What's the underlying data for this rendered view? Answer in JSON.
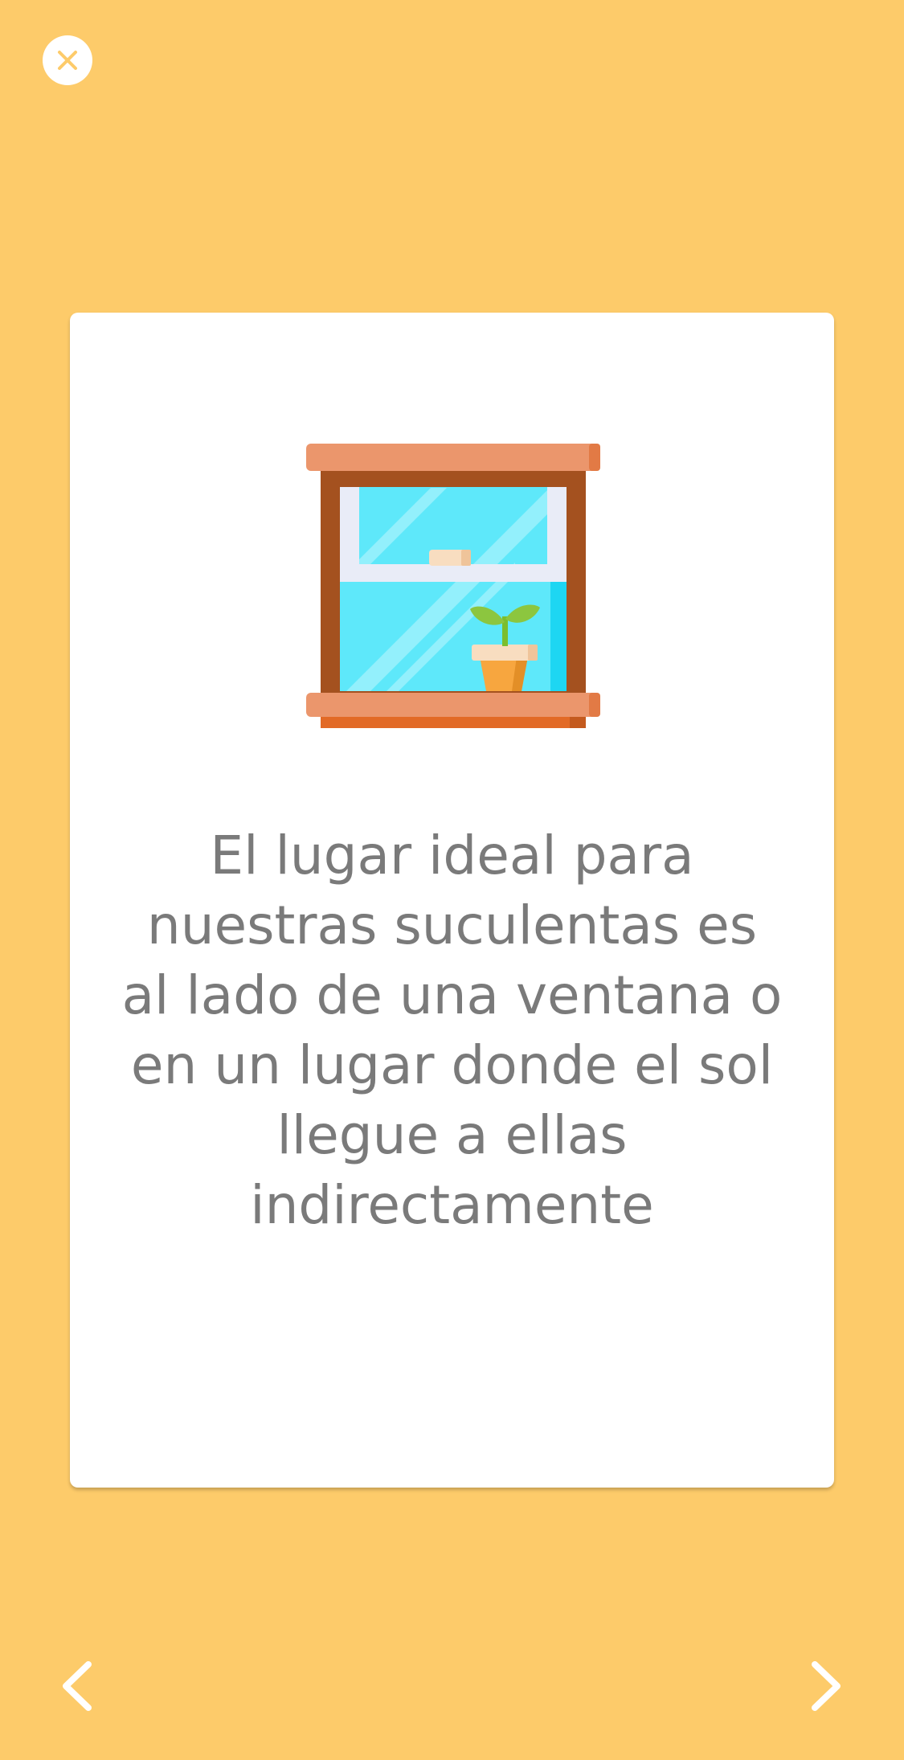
{
  "colors": {
    "background": "#FDCB6A",
    "card": "#FFFFFF",
    "text": "#7A7A7A",
    "icon": "#FFFFFF",
    "close_x": "#FDCB6A"
  },
  "header": {
    "close_icon": "close-icon"
  },
  "card": {
    "illustration": "window-with-plant-illustration",
    "text": "El lugar ideal para nuestras suculentas es al lado de una ventana o en un lugar donde el sol llegue a ellas indirectamente"
  },
  "navigation": {
    "prev_icon": "chevron-left-icon",
    "next_icon": "chevron-right-icon"
  }
}
